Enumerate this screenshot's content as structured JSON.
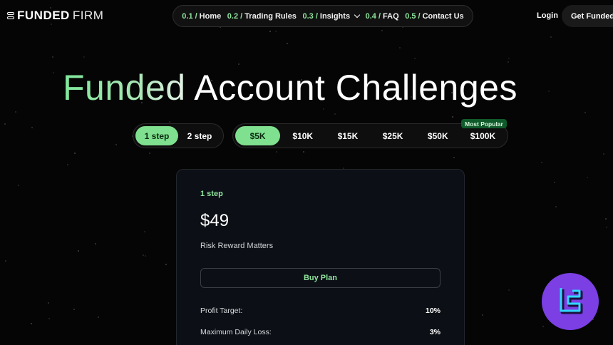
{
  "brand": {
    "name_bold": "FUNDED",
    "name_thin": "FIRM"
  },
  "nav": {
    "items": [
      {
        "num": "0.1 /",
        "label": "Home"
      },
      {
        "num": "0.2 /",
        "label": "Trading Rules"
      },
      {
        "num": "0.3 /",
        "label": "Insights"
      },
      {
        "num": "0.4 /",
        "label": "FAQ"
      },
      {
        "num": "0.5 /",
        "label": "Contact Us"
      }
    ],
    "login": "Login",
    "cta": "Get Funded"
  },
  "hero": {
    "title_green": "Funded",
    "title_white": " Account Challenges"
  },
  "steps": {
    "options": [
      "1 step",
      "2 step"
    ],
    "selected": "1 step"
  },
  "sizes": {
    "options": [
      "$5K",
      "$10K",
      "$15K",
      "$25K",
      "$50K",
      "$100K"
    ],
    "selected": "$5K",
    "popular_badge": "Most Popular"
  },
  "plan": {
    "step": "1 step",
    "price": "$49",
    "tagline": "Risk Reward Matters",
    "buy": "Buy Plan",
    "rules": [
      {
        "label": "Profit Target:",
        "value": "10%"
      },
      {
        "label": "Maximum Daily Loss:",
        "value": "3%"
      }
    ]
  },
  "colors": {
    "accent": "#7fe08f",
    "background": "#050505",
    "watermark": "#7b3fe4"
  }
}
